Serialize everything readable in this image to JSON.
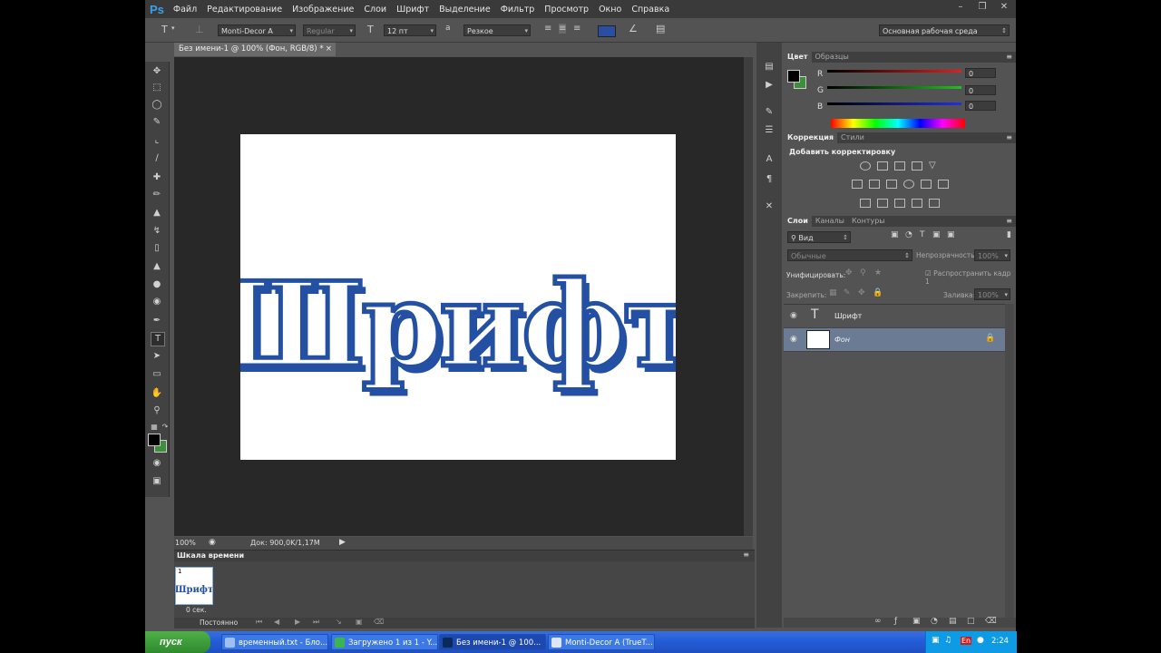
{
  "app": {
    "logo": "Ps",
    "menu": [
      "Файл",
      "Редактирование",
      "Изображение",
      "Слои",
      "Шрифт",
      "Выделение",
      "Фильтр",
      "Просмотр",
      "Окно",
      "Справка"
    ]
  },
  "options": {
    "font_family": "Monti-Decor A",
    "font_style": "Regular",
    "font_size": "12 пт",
    "antialias_label": "a",
    "antialias": "Резкое",
    "text_color": "#2a4fa0",
    "workspace": "Основная рабочая среда"
  },
  "document": {
    "tab_title": "Без имени-1 @ 100% (Фон, RGB/8) *",
    "text": "Шрифт",
    "text_color": "#2450a3",
    "zoom": "100%",
    "doc_size": "Док: 900,0K/1,17M"
  },
  "timeline": {
    "title": "Шкала времени",
    "frame_number": "1",
    "frame_delay": "0 сек.",
    "loop": "Постоянно"
  },
  "color_panel": {
    "tabs": [
      "Цвет",
      "Образцы"
    ],
    "channels": [
      {
        "label": "R",
        "value": "0",
        "color": "#e02020"
      },
      {
        "label": "G",
        "value": "0",
        "color": "#20c020"
      },
      {
        "label": "B",
        "value": "0",
        "color": "#2030e0"
      }
    ],
    "foreground": "#000000",
    "background": "#3e8e3e"
  },
  "adjustments_panel": {
    "tabs": [
      "Коррекция",
      "Стили"
    ],
    "heading": "Добавить корректировку"
  },
  "layers_panel": {
    "tabs": [
      "Слои",
      "Каналы",
      "Контуры"
    ],
    "filter_label": "Вид",
    "blend_mode": "Обычные",
    "opacity_label": "Непрозрачность:",
    "opacity": "100%",
    "unify_label": "Унифицировать:",
    "propagate_label": "Распространить кадр 1",
    "lock_label": "Закрепить:",
    "fill_label": "Заливка:",
    "fill": "100%",
    "layers": [
      {
        "name": "Шрифт",
        "type": "text",
        "selected": false
      },
      {
        "name": "Фон",
        "type": "background",
        "selected": true
      }
    ]
  },
  "taskbar": {
    "start": "пуск",
    "buttons": [
      "временный.txt - Бло...",
      "Загружено 1 из 1 - Y...",
      "Без имени-1 @ 100...",
      "Monti-Decor A (TrueT..."
    ],
    "lang": "En",
    "clock": "2:24"
  }
}
